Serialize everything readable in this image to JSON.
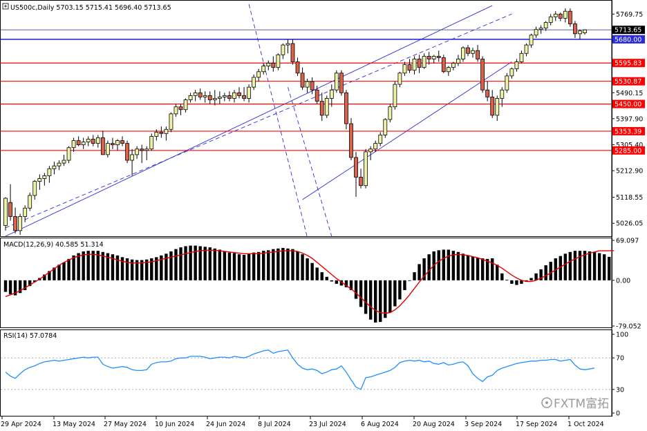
{
  "header": {
    "symbol_line": "US500c,Daily  5703.15 5715.41 5696.40 5713.65",
    "macd_label": "MACD(12,26,9) 40.585 51.314",
    "rsi_label": "RSI(14) 57.0784",
    "watermark": "FXTM富拓"
  },
  "colors": {
    "up_candle": "#eef2a8",
    "down_candle": "#d9624a",
    "support_resistance": "#ff0000",
    "channel": "#2b2bd9",
    "macd_signal": "#e60000",
    "rsi_line": "#1e90ff",
    "grid_level": "#9aa0a6"
  },
  "chart_data": [
    {
      "type": "candlestick",
      "panel": "price",
      "instrument": "US500c",
      "timeframe": "Daily",
      "ylim": [
        4980,
        5810
      ],
      "y_ticks": [
        5769.75,
        5490.15,
        5397.9,
        5305.4,
        5212.9,
        5118.55,
        5026.05
      ],
      "y_tick_labels": [
        "5769.75",
        "5490.15",
        "5397.90",
        "5305.40",
        "5212.90",
        "5118.55",
        "5026.05"
      ],
      "x_tick_labels": [
        "29 Apr 2024",
        "13 May 2024",
        "27 May 2024",
        "10 Jun 2024",
        "24 Jun 2024",
        "8 Jul 2024",
        "23 Jul 2024",
        "6 Aug 2024",
        "20 Aug 2024",
        "3 Sep 2024",
        "17 Sep 2024",
        "1 Oct 2024"
      ],
      "last": {
        "open": 5703.15,
        "high": 5715.41,
        "low": 5696.4,
        "close": 5713.65
      },
      "horizontal_levels": [
        {
          "value": 5713.65,
          "label": "5713.65",
          "style": "current"
        },
        {
          "value": 5680.0,
          "label": "5680.00",
          "style": "blue"
        },
        {
          "value": 5595.83,
          "label": "5595.83",
          "style": "red"
        },
        {
          "value": 5530.87,
          "label": "5530.87",
          "style": "red"
        },
        {
          "value": 5450.0,
          "label": "5450.00",
          "style": "red"
        },
        {
          "value": 5353.39,
          "label": "5353.39",
          "style": "red"
        },
        {
          "value": 5285.0,
          "label": "5285.00",
          "style": "red"
        }
      ],
      "trendlines": [
        {
          "from": [
            0,
            4980
          ],
          "to": [
            100,
            5800
          ],
          "style": "solid"
        },
        {
          "from": [
            0,
            5010
          ],
          "to": [
            104,
            5770
          ],
          "style": "dashed"
        },
        {
          "from": [
            61,
            5110
          ],
          "to": [
            104,
            5600
          ],
          "style": "solid"
        },
        {
          "from": [
            50,
            5805
          ],
          "to": [
            62,
            4975
          ],
          "style": "dashed"
        },
        {
          "from": [
            58,
            5510
          ],
          "to": [
            67,
            4980
          ],
          "style": "dashed"
        }
      ],
      "candles": [
        [
          5018,
          5118,
          5000,
          5115
        ],
        [
          5100,
          5165,
          5035,
          5050
        ],
        [
          5050,
          5082,
          4990,
          5000
        ],
        [
          5000,
          5060,
          4985,
          5050
        ],
        [
          5050,
          5090,
          5030,
          5080
        ],
        [
          5080,
          5135,
          5070,
          5125
        ],
        [
          5125,
          5180,
          5110,
          5175
        ],
        [
          5175,
          5200,
          5145,
          5185
        ],
        [
          5185,
          5205,
          5160,
          5195
        ],
        [
          5195,
          5230,
          5170,
          5220
        ],
        [
          5220,
          5245,
          5200,
          5230
        ],
        [
          5230,
          5250,
          5215,
          5240
        ],
        [
          5240,
          5270,
          5230,
          5250
        ],
        [
          5250,
          5300,
          5240,
          5295
        ],
        [
          5295,
          5330,
          5280,
          5320
        ],
        [
          5320,
          5335,
          5300,
          5305
        ],
        [
          5305,
          5330,
          5290,
          5315
        ],
        [
          5315,
          5335,
          5300,
          5325
        ],
        [
          5325,
          5340,
          5300,
          5310
        ],
        [
          5310,
          5340,
          5295,
          5330
        ],
        [
          5330,
          5355,
          5285,
          5270
        ],
        [
          5270,
          5320,
          5260,
          5310
        ],
        [
          5310,
          5330,
          5290,
          5305
        ],
        [
          5305,
          5325,
          5285,
          5320
        ],
        [
          5320,
          5335,
          5300,
          5310
        ],
        [
          5310,
          5320,
          5240,
          5250
        ],
        [
          5250,
          5290,
          5195,
          5270
        ],
        [
          5270,
          5300,
          5255,
          5290
        ],
        [
          5290,
          5305,
          5240,
          5285
        ],
        [
          5285,
          5300,
          5250,
          5290
        ],
        [
          5290,
          5345,
          5285,
          5335
        ],
        [
          5335,
          5360,
          5320,
          5350
        ],
        [
          5350,
          5370,
          5330,
          5345
        ],
        [
          5345,
          5370,
          5320,
          5360
        ],
        [
          5360,
          5420,
          5350,
          5415
        ],
        [
          5415,
          5450,
          5405,
          5440
        ],
        [
          5440,
          5450,
          5410,
          5430
        ],
        [
          5430,
          5470,
          5420,
          5465
        ],
        [
          5465,
          5490,
          5455,
          5480
        ],
        [
          5480,
          5500,
          5460,
          5490
        ],
        [
          5490,
          5505,
          5465,
          5475
        ],
        [
          5475,
          5495,
          5455,
          5480
        ],
        [
          5480,
          5495,
          5450,
          5465
        ],
        [
          5465,
          5500,
          5445,
          5470
        ],
        [
          5470,
          5495,
          5450,
          5475
        ],
        [
          5475,
          5490,
          5460,
          5480
        ],
        [
          5480,
          5495,
          5460,
          5470
        ],
        [
          5470,
          5500,
          5455,
          5490
        ],
        [
          5490,
          5510,
          5470,
          5480
        ],
        [
          5480,
          5510,
          5460,
          5470
        ],
        [
          5470,
          5520,
          5455,
          5510
        ],
        [
          5510,
          5555,
          5500,
          5545
        ],
        [
          5545,
          5575,
          5530,
          5565
        ],
        [
          5565,
          5595,
          5555,
          5585
        ],
        [
          5585,
          5605,
          5570,
          5595
        ],
        [
          5595,
          5620,
          5565,
          5580
        ],
        [
          5580,
          5630,
          5570,
          5625
        ],
        [
          5625,
          5665,
          5610,
          5660
        ],
        [
          5660,
          5680,
          5630,
          5665
        ],
        [
          5665,
          5680,
          5590,
          5600
        ],
        [
          5600,
          5615,
          5550,
          5560
        ],
        [
          5560,
          5580,
          5500,
          5510
        ],
        [
          5510,
          5540,
          5490,
          5530
        ],
        [
          5530,
          5545,
          5485,
          5500
        ],
        [
          5500,
          5515,
          5450,
          5460
        ],
        [
          5460,
          5490,
          5390,
          5410
        ],
        [
          5410,
          5480,
          5400,
          5470
        ],
        [
          5470,
          5520,
          5440,
          5500
        ],
        [
          5500,
          5570,
          5490,
          5560
        ],
        [
          5560,
          5570,
          5480,
          5490
        ],
        [
          5490,
          5500,
          5360,
          5380
        ],
        [
          5380,
          5400,
          5250,
          5260
        ],
        [
          5260,
          5280,
          5120,
          5190
        ],
        [
          5190,
          5220,
          5150,
          5160
        ],
        [
          5160,
          5290,
          5150,
          5280
        ],
        [
          5280,
          5300,
          5250,
          5290
        ],
        [
          5290,
          5320,
          5280,
          5310
        ],
        [
          5310,
          5350,
          5300,
          5340
        ],
        [
          5340,
          5400,
          5330,
          5395
        ],
        [
          5395,
          5450,
          5385,
          5440
        ],
        [
          5440,
          5530,
          5430,
          5520
        ],
        [
          5520,
          5565,
          5510,
          5560
        ],
        [
          5560,
          5600,
          5550,
          5590
        ],
        [
          5590,
          5610,
          5560,
          5570
        ],
        [
          5570,
          5620,
          5555,
          5610
        ],
        [
          5610,
          5625,
          5560,
          5580
        ],
        [
          5580,
          5630,
          5575,
          5620
        ],
        [
          5620,
          5635,
          5590,
          5610
        ],
        [
          5610,
          5625,
          5595,
          5620
        ],
        [
          5620,
          5640,
          5600,
          5615
        ],
        [
          5615,
          5625,
          5560,
          5565
        ],
        [
          5565,
          5585,
          5550,
          5580
        ],
        [
          5580,
          5600,
          5570,
          5595
        ],
        [
          5595,
          5625,
          5585,
          5610
        ],
        [
          5610,
          5655,
          5600,
          5650
        ],
        [
          5650,
          5660,
          5620,
          5630
        ],
        [
          5630,
          5650,
          5615,
          5640
        ],
        [
          5640,
          5660,
          5600,
          5610
        ],
        [
          5610,
          5620,
          5490,
          5500
        ],
        [
          5500,
          5530,
          5460,
          5475
        ],
        [
          5475,
          5500,
          5400,
          5410
        ],
        [
          5410,
          5480,
          5390,
          5470
        ],
        [
          5470,
          5510,
          5440,
          5500
        ],
        [
          5500,
          5560,
          5490,
          5550
        ],
        [
          5550,
          5580,
          5540,
          5575
        ],
        [
          5575,
          5610,
          5565,
          5600
        ],
        [
          5600,
          5640,
          5595,
          5630
        ],
        [
          5630,
          5665,
          5620,
          5660
        ],
        [
          5660,
          5700,
          5650,
          5695
        ],
        [
          5695,
          5725,
          5685,
          5715
        ],
        [
          5715,
          5730,
          5700,
          5720
        ],
        [
          5720,
          5745,
          5710,
          5740
        ],
        [
          5740,
          5770,
          5730,
          5760
        ],
        [
          5760,
          5780,
          5745,
          5770
        ],
        [
          5770,
          5775,
          5745,
          5755
        ],
        [
          5755,
          5790,
          5740,
          5780
        ],
        [
          5780,
          5790,
          5725,
          5735
        ],
        [
          5735,
          5745,
          5685,
          5700
        ],
        [
          5700,
          5715,
          5680,
          5710
        ],
        [
          5703.15,
          5715.41,
          5696.4,
          5713.65
        ]
      ]
    },
    {
      "type": "histogram+line",
      "panel": "macd",
      "title": "MACD(12,26,9) 40.585 51.314",
      "ylim": [
        -79.052,
        69.097
      ],
      "y_tick_labels": [
        "69.097",
        "0.00",
        "-79.052"
      ],
      "y_ticks": [
        69.097,
        0,
        -79.052
      ],
      "histogram": [
        -20,
        -24,
        -26,
        -22,
        -17,
        -10,
        -3,
        4,
        10,
        16,
        22,
        27,
        31,
        37,
        43,
        47,
        50,
        51,
        51,
        51,
        49,
        47,
        45,
        43,
        40,
        38,
        36,
        35,
        35,
        36,
        38,
        40,
        43,
        46,
        50,
        54,
        57,
        59,
        60,
        60,
        59,
        58,
        57,
        55,
        53,
        50,
        48,
        47,
        45,
        44,
        46,
        48,
        49,
        51,
        52,
        54,
        55,
        56,
        55,
        54,
        50,
        45,
        38,
        30,
        22,
        14,
        6,
        -2,
        -6,
        -9,
        -12,
        -17,
        -32,
        -46,
        -58,
        -68,
        -73,
        -72,
        -65,
        -56,
        -45,
        -33,
        -17,
        -1,
        14,
        28,
        38,
        45,
        50,
        52,
        53,
        53,
        51,
        49,
        46,
        43,
        41,
        39,
        38,
        37,
        38,
        27,
        12,
        1,
        -6,
        -8,
        -6,
        -2,
        4,
        12,
        19,
        26,
        32,
        38,
        42,
        46,
        49,
        51,
        51,
        51,
        50,
        49,
        47,
        45,
        40.585
      ],
      "signal": [
        -28,
        -25,
        -22,
        -18,
        -13,
        -8,
        -3,
        2,
        8,
        14,
        20,
        26,
        31,
        35,
        39,
        42,
        44,
        45,
        45,
        44,
        42,
        40,
        38,
        35,
        33,
        31,
        30,
        30,
        30,
        31,
        32,
        34,
        36,
        38,
        40,
        42,
        44,
        46,
        48,
        50,
        51,
        52,
        52,
        52,
        51,
        50,
        49,
        48,
        47,
        46,
        46,
        46,
        46,
        47,
        48,
        49,
        50,
        51,
        51,
        51,
        50,
        47,
        43,
        38,
        31,
        24,
        17,
        10,
        3,
        -3,
        -9,
        -15,
        -22,
        -30,
        -38,
        -46,
        -52,
        -56,
        -57,
        -56,
        -51,
        -44,
        -35,
        -25,
        -14,
        -3,
        7,
        17,
        26,
        33,
        38,
        42,
        44,
        45,
        44,
        43,
        41,
        39,
        36,
        33,
        30,
        26,
        21,
        15,
        9,
        4,
        0,
        -2,
        -2,
        0,
        4,
        8,
        13,
        18,
        23,
        28,
        33,
        37,
        41,
        44,
        47,
        49,
        51,
        51,
        51,
        51.314
      ]
    },
    {
      "type": "line",
      "panel": "rsi",
      "title": "RSI(14) 57.0784",
      "ylim": [
        0,
        100
      ],
      "y_ticks": [
        100,
        70,
        30,
        0
      ],
      "y_tick_labels": [
        "100",
        "70",
        "30",
        "0"
      ],
      "values": [
        52,
        47,
        44,
        50,
        55,
        58,
        60,
        63,
        65,
        66,
        67,
        66,
        67,
        68,
        69,
        70,
        71,
        70,
        71,
        71,
        62,
        59,
        57,
        58,
        59,
        58,
        55,
        54,
        54,
        55,
        62,
        64,
        65,
        65,
        66,
        69,
        70,
        70,
        72,
        72,
        72,
        71,
        69,
        70,
        71,
        71,
        70,
        72,
        71,
        70,
        72,
        75,
        77,
        79,
        80,
        76,
        78,
        79,
        80,
        70,
        62,
        57,
        55,
        56,
        54,
        50,
        52,
        55,
        56,
        60,
        52,
        42,
        33,
        30,
        45,
        46,
        48,
        50,
        52,
        54,
        58,
        64,
        66,
        67,
        66,
        67,
        65,
        66,
        63,
        62,
        64,
        61,
        62,
        64,
        65,
        60,
        50,
        44,
        40,
        46,
        48,
        54,
        57,
        59,
        61,
        63,
        64,
        65,
        66,
        66,
        67,
        67,
        68,
        68,
        66,
        67,
        68,
        61,
        56,
        55,
        56,
        57.0784
      ]
    }
  ]
}
